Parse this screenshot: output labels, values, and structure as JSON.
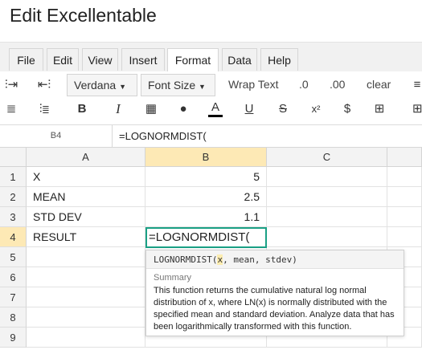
{
  "app": {
    "title": "Edit Excellentable"
  },
  "menu": {
    "tabs": [
      {
        "label": "File"
      },
      {
        "label": "Edit"
      },
      {
        "label": "View"
      },
      {
        "label": "Insert"
      },
      {
        "label": "Format",
        "active": true
      },
      {
        "label": "Data"
      },
      {
        "label": "Help"
      }
    ]
  },
  "toolbar": {
    "font_family": "Verdana",
    "font_size": "Font Size",
    "wrap_text": "Wrap Text",
    "decimal_decrease": ".0",
    "decimal_increase": ".00",
    "clear": "clear",
    "icons": [
      "insert-column-left-icon",
      "insert-column-right-icon",
      "align-left-icon",
      "align-right-icon",
      "bold-icon",
      "italic-icon",
      "borders-icon",
      "fill-color-icon",
      "text-color-icon",
      "underline-icon",
      "strikethrough-icon",
      "superscript-icon",
      "currency-icon",
      "merge-cells-icon"
    ],
    "text_color": "#000000"
  },
  "formula_bar": {
    "cell_ref": "B4",
    "formula": "=LOGNORMDIST("
  },
  "grid": {
    "columns": [
      "A",
      "B",
      "C"
    ],
    "selected_column": "B",
    "rows": [
      {
        "num": "1",
        "a": "X",
        "b": "5"
      },
      {
        "num": "2",
        "a": "MEAN",
        "b": "2.5"
      },
      {
        "num": "3",
        "a": "STD DEV",
        "b": "1.1"
      },
      {
        "num": "4",
        "a": "RESULT",
        "b": ""
      },
      {
        "num": "5",
        "a": "",
        "b": ""
      },
      {
        "num": "6",
        "a": "",
        "b": ""
      },
      {
        "num": "7",
        "a": "",
        "b": ""
      },
      {
        "num": "8",
        "a": "",
        "b": ""
      },
      {
        "num": "9",
        "a": "",
        "b": ""
      }
    ],
    "selected_row": "4",
    "editing_value": "=LOGNORMDIST(",
    "accent_color": "#1aa085",
    "header_highlight_color": "#fde9b5"
  },
  "tooltip": {
    "fn_name": "LOGNORMDIST(",
    "arg_active": "x",
    "arg_rest": ", mean, stdev)",
    "summary_label": "Summary",
    "description": "This function returns the cumulative natural log normal distribution of x, where LN(x) is normally distributed with the specified mean and standard deviation. Analyze data that has been logarithmically transformed with this function."
  }
}
